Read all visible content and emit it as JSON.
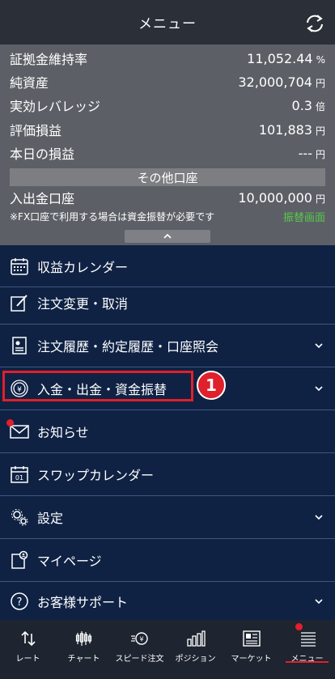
{
  "header": {
    "title": "メニュー",
    "refresh_icon": "refresh-icon"
  },
  "summary": {
    "rows": [
      {
        "label": "証拠金維持率",
        "value": "11,052.44",
        "unit": "%"
      },
      {
        "label": "純資産",
        "value": "32,000,704",
        "unit": "円"
      },
      {
        "label": "実効レバレッジ",
        "value": "0.3",
        "unit": "倍"
      },
      {
        "label": "評価損益",
        "value": "101,883",
        "unit": "円"
      },
      {
        "label": "本日の損益",
        "value": "---",
        "unit": "円"
      }
    ],
    "other_account_label": "その他口座",
    "deposit_row": {
      "label": "入出金口座",
      "value": "10,000,000",
      "unit": "円"
    },
    "note": "※FX口座で利用する場合は資金振替が必要です",
    "transfer_link": "振替画面"
  },
  "menu": {
    "items": [
      {
        "label": "収益カレンダー",
        "icon": "calendar-icon",
        "expandable": false
      },
      {
        "label": "注文変更・取消",
        "icon": "edit-icon",
        "expandable": false
      },
      {
        "label": "注文履歴・約定履歴・口座照会",
        "icon": "document-icon",
        "expandable": true
      },
      {
        "label": "入金・出金・資金振替",
        "icon": "yen-coin-icon",
        "expandable": true
      },
      {
        "label": "お知らせ",
        "icon": "mail-icon",
        "expandable": false
      },
      {
        "label": "スワップカレンダー",
        "icon": "swap-calendar-icon",
        "expandable": false
      },
      {
        "label": "設定",
        "icon": "gear-icon",
        "expandable": true
      },
      {
        "label": "マイページ",
        "icon": "mypage-icon",
        "expandable": false
      },
      {
        "label": "お客様サポート",
        "icon": "help-icon",
        "expandable": true
      }
    ],
    "step_badge": "1"
  },
  "tabbar": {
    "tabs": [
      {
        "label": "レート",
        "icon": "rate-arrows-icon"
      },
      {
        "label": "チャート",
        "icon": "candlestick-icon"
      },
      {
        "label": "スピード注文",
        "icon": "speed-order-icon"
      },
      {
        "label": "ポジション",
        "icon": "position-bars-icon"
      },
      {
        "label": "マーケット",
        "icon": "news-icon"
      },
      {
        "label": "メニュー",
        "icon": "menu-list-icon"
      }
    ],
    "active_index": 5
  },
  "colors": {
    "accent_red": "#e0202a",
    "link_green": "#56c94a",
    "menu_bg": "#0f2244",
    "summary_bg": "#5c6066"
  }
}
